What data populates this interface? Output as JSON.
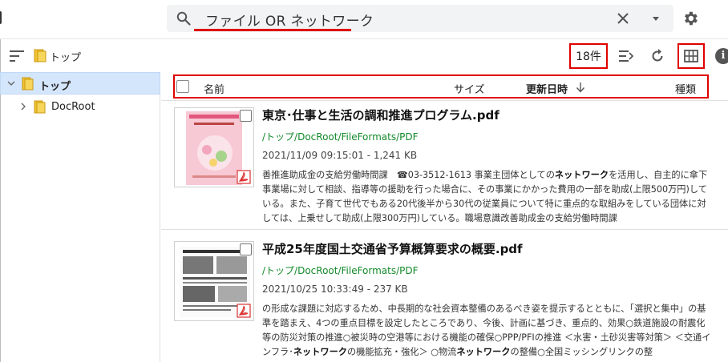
{
  "search": {
    "query": "ファイル OR ネットワーク"
  },
  "toolbar": {
    "breadcrumb": "トップ",
    "result_count": "18件"
  },
  "sidebar": {
    "items": [
      {
        "label": "トップ",
        "selected": true,
        "expanded": true
      },
      {
        "label": "DocRoot",
        "selected": false,
        "expanded": false
      }
    ]
  },
  "table_header": {
    "name": "名前",
    "size": "サイズ",
    "updated": "更新日時",
    "kind": "種類",
    "sort": "descending"
  },
  "results": [
    {
      "title": "東京･仕事と生活の調和推進プログラム.pdf",
      "path": "/トップ/DocRoot/FileFormats/PDF",
      "meta": "2021/11/09 09:15:01 - 1,241 KB",
      "snippet": [
        "善推進助成金の支給労働時間課　﻿☎03-3512-1613 事業主団体としての",
        "ネットワーク",
        "を活用し、自主的に傘下事業場に対して相談、指導等の援助を行った場合に、その事業にかかった費用の一部を助成(上限500万円)している。また、子育て世代でもある20代後半から30代の従業員について特に重点的な取組みをしている団体に対しては、上乗せして助成(上限300万円)している。職場意識改善助成金の支給労働時間課"
      ]
    },
    {
      "title": "平成25年度国土交通省予算概算要求の概要.pdf",
      "path": "/トップ/DocRoot/FileFormats/PDF",
      "meta": "2021/10/25 10:33:49 - 237 KB",
      "snippet": [
        "の形成な課題に対応するため、中長期的な社会資本整備のあるべき姿を提示するとともに、「選択と集中」の基準を踏まえ、4つの重点目標を設定したところであり、今後、計画に基づき、重点的、効果○鉄道施設の耐震化等の防災対策の推進○被災時の空港等における機能の確保○PPP/PFIの推進 ＜水害・土砂災害等対策＞ ＜交通インフラ･",
        "ネットワーク",
        "の機能拡充・強化＞ ○物流",
        "ネットワーク",
        "の整備○全国ミッシングリンクの整"
      ]
    }
  ],
  "colors": {
    "highlight_box": "#e00000",
    "path_green": "#138a2b",
    "selected_bg": "#d4e6fb",
    "folder_yellow": "#f2c230"
  }
}
